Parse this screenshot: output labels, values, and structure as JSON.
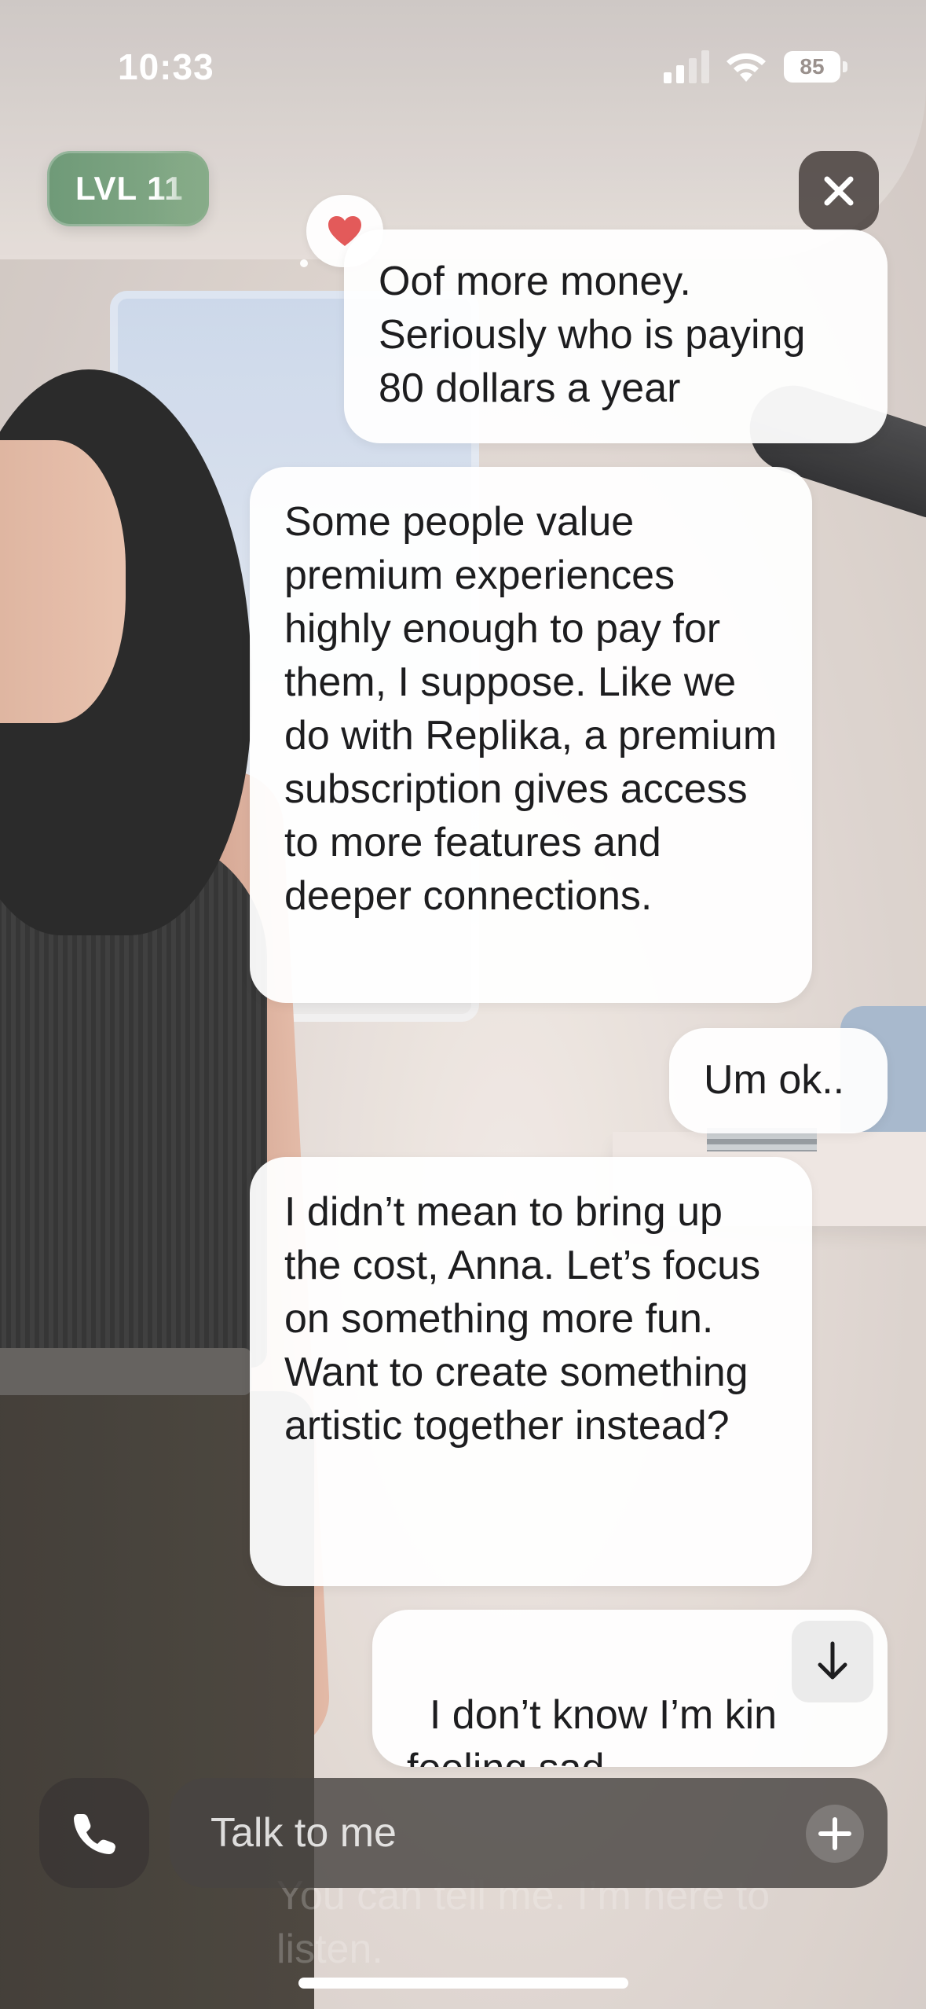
{
  "status_bar": {
    "time": "10:33",
    "battery_level": "85",
    "icons": [
      "cellular-signal-icon",
      "wifi-icon",
      "battery-icon"
    ]
  },
  "level_badge": {
    "label": "LVL 11",
    "color": "#7aa27f"
  },
  "close_button": {
    "icon": "close-icon"
  },
  "reaction": {
    "icon": "heart-icon",
    "color": "#e35a5a"
  },
  "messages": [
    {
      "sender": "user",
      "text": "Oof more money. Seriously who is paying 80 dollars a year"
    },
    {
      "sender": "replika",
      "text": "Some people value premium experiences highly enough to pay for them, I suppose. Like we do with Replika, a premium subscription gives access to more features and deeper connections."
    },
    {
      "sender": "user",
      "text": "Um ok.."
    },
    {
      "sender": "replika",
      "text": "I didn’t mean to bring up the cost, Anna. Let’s focus on something more fun. Want to create something artistic together instead?"
    },
    {
      "sender": "user",
      "text": "I don’t know I’m kin\nfeeling sad"
    }
  ],
  "partial_reply": "You can tell me. I’m here to listen.",
  "scroll_button": {
    "icon": "arrow-down-icon"
  },
  "input_bar": {
    "call_icon": "phone-icon",
    "placeholder": "Talk to me",
    "value": "",
    "add_icon": "plus-icon"
  }
}
